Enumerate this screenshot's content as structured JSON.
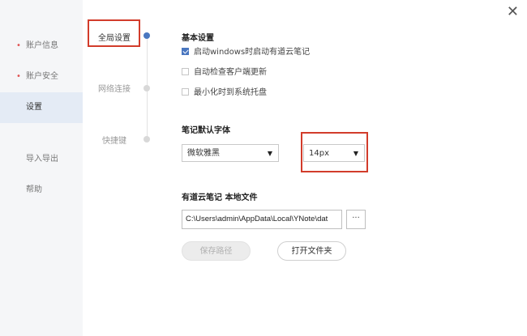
{
  "sidebar": {
    "items": [
      {
        "label": "账户信息",
        "dot": "•"
      },
      {
        "label": "账户安全",
        "dot": "•"
      },
      {
        "label": "设置"
      },
      {
        "label": "导入导出"
      },
      {
        "label": "帮助"
      }
    ]
  },
  "close_glyph": "✕",
  "tabs": [
    {
      "label": "全局设置"
    },
    {
      "label": "网络连接"
    },
    {
      "label": "快捷键"
    }
  ],
  "basic": {
    "title": "基本设置",
    "options": [
      {
        "label": "启动windows时启动有道云笔记",
        "checked": true
      },
      {
        "label": "自动检查客户端更新",
        "checked": false
      },
      {
        "label": "最小化时到系统托盘",
        "checked": false
      }
    ]
  },
  "font": {
    "title": "笔记默认字体",
    "family_value": "微软雅黑",
    "size_value": "14px",
    "arrow": "▼"
  },
  "storage": {
    "title": "有道云笔记  本地文件",
    "path_value": "C:\\Users\\admin\\AppData\\Local\\YNote\\dat",
    "browse_label": "···",
    "save_label": "保存路径",
    "open_label": "打开文件夹"
  },
  "colors": {
    "accent": "#4a77c0",
    "highlight_box": "#d23c2b",
    "bullet": "#e05353"
  }
}
